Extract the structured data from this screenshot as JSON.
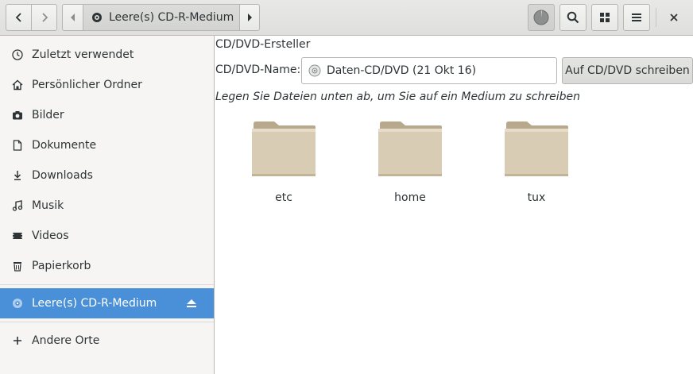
{
  "header": {
    "path_current": "Leere(s) CD-R-Medium"
  },
  "sidebar": {
    "items": [
      {
        "label": "Zuletzt verwendet",
        "icon": "clock-icon"
      },
      {
        "label": "Persönlicher Ordner",
        "icon": "home-icon"
      },
      {
        "label": "Bilder",
        "icon": "camera-icon"
      },
      {
        "label": "Dokumente",
        "icon": "document-icon"
      },
      {
        "label": "Downloads",
        "icon": "download-icon"
      },
      {
        "label": "Musik",
        "icon": "music-icon"
      },
      {
        "label": "Videos",
        "icon": "video-icon"
      },
      {
        "label": "Papierkorb",
        "icon": "trash-icon"
      }
    ],
    "device": {
      "label": "Leere(s) CD-R-Medium",
      "icon": "optical-disc-icon"
    },
    "other": {
      "label": "Andere Orte",
      "icon": "plus-icon"
    }
  },
  "burner": {
    "title": "CD/DVD-Ersteller",
    "name_label": "CD/DVD-Name:",
    "name_value": "Daten-CD/DVD (21 Okt 16)",
    "burn_button": "Auf CD/DVD schreiben",
    "hint": "Legen Sie Dateien unten ab, um Sie auf ein Medium zu schreiben"
  },
  "files": [
    {
      "name": "etc",
      "icon": "folder-icon"
    },
    {
      "name": "home",
      "icon": "folder-icon"
    },
    {
      "name": "tux",
      "icon": "folder-icon"
    }
  ],
  "colors": {
    "accent": "#4a90d9",
    "folder": "#d9ccb4"
  }
}
